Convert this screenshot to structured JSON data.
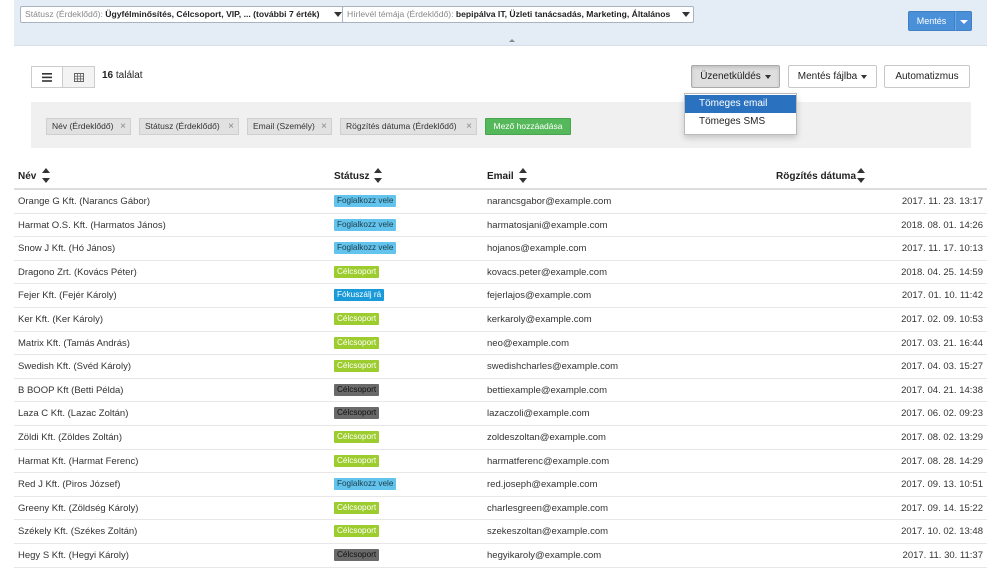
{
  "colors": {
    "accent": "#4a90d9",
    "menu_selected": "#2a72c0",
    "add_field_green": "#55b85a",
    "status": {
      "Foglalkozz vele": {
        "bg": "#62c4ec",
        "fg": "#1d3b4a"
      },
      "Célcsoport": {
        "bg": "#9ccc2e",
        "fg": "#ffffff"
      },
      "Fókuszálj rá": {
        "bg": "#1a9ad8",
        "fg": "#ffffff"
      },
      "Célcsoport-dark": {
        "bg": "#6a6a6a",
        "fg": "#111111"
      }
    }
  },
  "filters": {
    "status_label": "Státusz (Érdeklődő): ",
    "status_value": "Ügyfélminősítés, Célcsoport, VIP, ... (további 7 érték)",
    "newsletter_label": "Hírlevél témája (Érdeklődő): ",
    "newsletter_value": "bepipálva IT, Üzleti tanácsadás, Marketing, Általános"
  },
  "save_button": "Mentés",
  "toolbar": {
    "result_count": "16",
    "result_suffix": " találat",
    "messaging": "Üzenetküldés",
    "save_to_file": "Mentés fájlba",
    "automation": "Automatizmus"
  },
  "messaging_menu": [
    "Tömeges email",
    "Tömeges SMS"
  ],
  "fields": {
    "chips": [
      "Név (Érdeklődő)",
      "Státusz (Érdeklődő)",
      "Email (Személy)",
      "Rögzítés dátuma (Érdeklődő)"
    ],
    "add_label": "Mező hozzáadása"
  },
  "table": {
    "columns": [
      "Név",
      "Státusz",
      "Email",
      "Rögzítés dátuma"
    ],
    "rows": [
      {
        "name": "Orange G Kft. (Narancs Gábor)",
        "status": "Foglalkozz vele",
        "style": "Foglalkozz vele",
        "email": "narancsgabor@example.com",
        "date": "2017. 11. 23. 13:17"
      },
      {
        "name": "Harmat O.S. Kft. (Harmatos János)",
        "status": "Foglalkozz vele",
        "style": "Foglalkozz vele",
        "email": "harmatosjani@example.com",
        "date": "2018. 08. 01. 14:26"
      },
      {
        "name": "Snow J Kft. (Hó János)",
        "status": "Foglalkozz vele",
        "style": "Foglalkozz vele",
        "email": "hojanos@example.com",
        "date": "2017. 11. 17. 10:13"
      },
      {
        "name": "Dragono Zrt. (Kovács Péter)",
        "status": "Célcsoport",
        "style": "Célcsoport",
        "email": "kovacs.peter@example.com",
        "date": "2018. 04. 25. 14:59"
      },
      {
        "name": "Fejer Kft. (Fejér Károly)",
        "status": "Fókuszálj rá",
        "style": "Fókuszálj rá",
        "email": "fejerlajos@example.com",
        "date": "2017. 01. 10. 11:42"
      },
      {
        "name": "Ker Kft. (Ker Károly)",
        "status": "Célcsoport",
        "style": "Célcsoport",
        "email": "kerkaroly@example.com",
        "date": "2017. 02. 09. 10:53"
      },
      {
        "name": "Matrix Kft. (Tamás András)",
        "status": "Célcsoport",
        "style": "Célcsoport",
        "email": "neo@example.com",
        "date": "2017. 03. 21. 16:44"
      },
      {
        "name": "Swedish Kft. (Svéd Károly)",
        "status": "Célcsoport",
        "style": "Célcsoport",
        "email": "swedishcharles@example.com",
        "date": "2017. 04. 03. 15:27"
      },
      {
        "name": "B BOOP Kft (Betti Példa)",
        "status": "Célcsoport",
        "style": "Célcsoport-dark",
        "email": "bettiexample@example.com",
        "date": "2017. 04. 21. 14:38"
      },
      {
        "name": "Laza C Kft. (Lazac Zoltán)",
        "status": "Célcsoport",
        "style": "Célcsoport-dark",
        "email": "lazaczoli@example.com",
        "date": "2017. 06. 02. 09:23"
      },
      {
        "name": "Zöldi Kft. (Zöldes Zoltán)",
        "status": "Célcsoport",
        "style": "Célcsoport",
        "email": "zoldeszoltan@example.com",
        "date": "2017. 08. 02. 13:29"
      },
      {
        "name": "Harmat Kft. (Harmat Ferenc)",
        "status": "Célcsoport",
        "style": "Célcsoport",
        "email": "harmatferenc@example.com",
        "date": "2017. 08. 28. 14:29"
      },
      {
        "name": "Red J Kft. (Piros József)",
        "status": "Foglalkozz vele",
        "style": "Foglalkozz vele",
        "email": "red.joseph@example.com",
        "date": "2017. 09. 13. 10:51"
      },
      {
        "name": "Greeny Kft. (Zöldség Károly)",
        "status": "Célcsoport",
        "style": "Célcsoport",
        "email": "charlesgreen@example.com",
        "date": "2017. 09. 14. 15:22"
      },
      {
        "name": "Székely Kft. (Székes Zoltán)",
        "status": "Célcsoport",
        "style": "Célcsoport",
        "email": "szekeszoltan@example.com",
        "date": "2017. 10. 02. 13:48"
      },
      {
        "name": "Hegy S Kft. (Hegyi Károly)",
        "status": "Célcsoport",
        "style": "Célcsoport-dark",
        "email": "hegyikaroly@example.com",
        "date": "2017. 11. 30. 11:37"
      }
    ]
  }
}
